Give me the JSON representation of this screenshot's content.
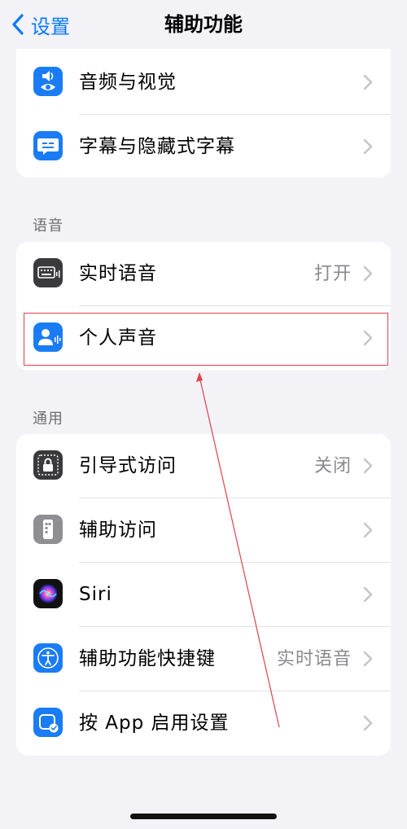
{
  "nav": {
    "back_label": "设置",
    "title": "辅助功能"
  },
  "groups": {
    "vision": [
      {
        "label": "音频与视觉",
        "value": ""
      },
      {
        "label": "字幕与隐藏式字幕",
        "value": ""
      }
    ],
    "speech_header": "语音",
    "speech": [
      {
        "label": "实时语音",
        "value": "打开"
      },
      {
        "label": "个人声音",
        "value": ""
      }
    ],
    "general_header": "通用",
    "general": [
      {
        "label": "引导式访问",
        "value": "关闭"
      },
      {
        "label": "辅助访问",
        "value": ""
      },
      {
        "label": "Siri",
        "value": ""
      },
      {
        "label": "辅助功能快捷键",
        "value": "实时语音"
      },
      {
        "label": "按 App 启用设置",
        "value": ""
      }
    ]
  },
  "colors": {
    "accent": "#0a7aff",
    "highlight": "#e0424a",
    "icon_blue": "#1a7cf5",
    "icon_gray": "#8e8e93",
    "icon_dark": "#3a3a3c"
  },
  "icons": {
    "audio_visual": "speaker-eye-icon",
    "captions": "caption-bubble-icon",
    "live_speech": "keyboard-waveform-icon",
    "personal_voice": "person-waveform-icon",
    "guided_access": "lock-frame-icon",
    "assistive_access": "phone-grid-icon",
    "siri": "siri-orb-icon",
    "shortcut": "accessibility-figure-icon",
    "per_app": "app-check-icon"
  }
}
